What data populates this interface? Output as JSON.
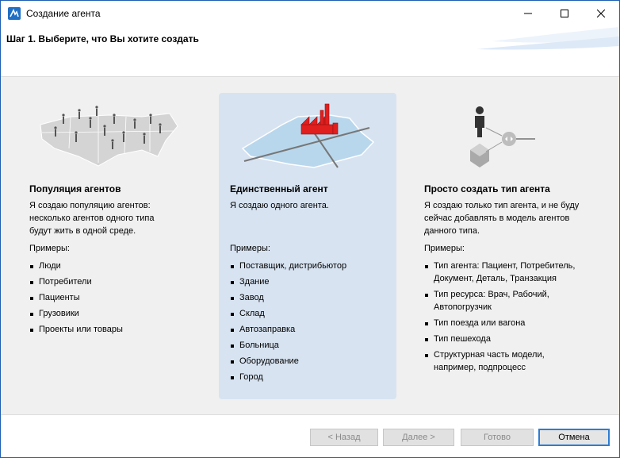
{
  "window": {
    "title": "Создание агента"
  },
  "header": {
    "step_title": "Шаг 1. Выберите, что Вы хотите создать"
  },
  "options": [
    {
      "title": "Популяция агентов",
      "description": [
        "Я создаю популяцию агентов:",
        "несколько агентов одного типа",
        "будут жить в одной среде."
      ],
      "examples_label": "Примеры:",
      "examples": [
        "Люди",
        "Потребители",
        "Пациенты",
        "Грузовики",
        "Проекты или товары"
      ]
    },
    {
      "title": "Единственный агент",
      "description": [
        "Я создаю одного агента."
      ],
      "examples_label": "Примеры:",
      "examples": [
        "Поставщик, дистрибьютор",
        "Здание",
        "Завод",
        "Склад",
        "Автозаправка",
        "Больница",
        "Оборудование",
        "Город"
      ]
    },
    {
      "title": "Просто создать тип агента",
      "description": [
        "Я создаю только тип агента, и не буду",
        "сейчас добавлять в модель агентов",
        "данного типа."
      ],
      "examples_label": "Примеры:",
      "examples": [
        [
          "Тип агента: Пациент, Потребитель,",
          "Документ, Деталь, Транзакция"
        ],
        [
          "Тип ресурса: Врач, Рабочий,",
          "Автопогрузчик"
        ],
        [
          "Тип поезда или вагона"
        ],
        [
          "Тип пешехода"
        ],
        [
          "Структурная часть модели,",
          "например, подпроцесс"
        ]
      ]
    }
  ],
  "buttons": {
    "back": "< Назад",
    "next": "Далее >",
    "finish": "Готово",
    "cancel": "Отмена"
  }
}
